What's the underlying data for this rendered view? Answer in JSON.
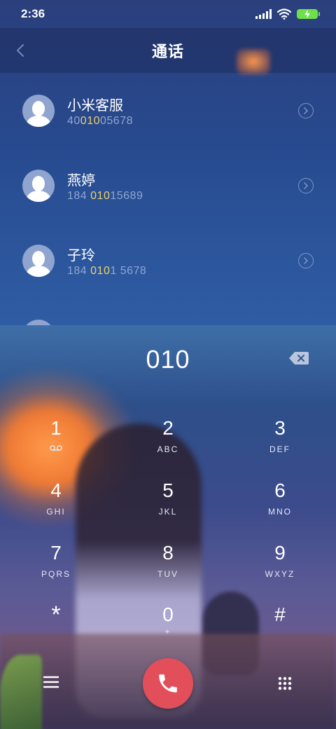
{
  "status_bar": {
    "time": "2:36"
  },
  "header": {
    "title": "通话"
  },
  "contacts": [
    {
      "name": "小米客服",
      "number_pre": "40",
      "number_match": "010",
      "number_post": "05678"
    },
    {
      "name": "燕婷",
      "number_pre": "184 ",
      "number_match": "010",
      "number_post": "15689"
    },
    {
      "name": "子玲",
      "number_pre": "184 ",
      "number_match": "010",
      "number_post": "1 5678"
    }
  ],
  "dialer": {
    "number": "010",
    "keys": [
      {
        "digit": "1",
        "letters": ""
      },
      {
        "digit": "2",
        "letters": "ABC"
      },
      {
        "digit": "3",
        "letters": "DEF"
      },
      {
        "digit": "4",
        "letters": "GHI"
      },
      {
        "digit": "5",
        "letters": "JKL"
      },
      {
        "digit": "6",
        "letters": "MNO"
      },
      {
        "digit": "7",
        "letters": "PQRS"
      },
      {
        "digit": "8",
        "letters": "TUV"
      },
      {
        "digit": "9",
        "letters": "WXYZ"
      },
      {
        "digit": "*",
        "letters": ""
      },
      {
        "digit": "0",
        "letters": "+"
      },
      {
        "digit": "#",
        "letters": ""
      }
    ]
  },
  "colors": {
    "match_highlight": "#f1d06a",
    "number_gray": "#8fa7d0",
    "call_button": "#e24f5b",
    "battery": "#6ee04a"
  },
  "icons": {
    "back": "chevron-left-icon",
    "detail": "chevron-right-circle-icon",
    "backspace": "backspace-icon",
    "voicemail": "voicemail-icon",
    "menu": "menu-icon",
    "call": "phone-icon",
    "keypad": "dialpad-icon"
  }
}
